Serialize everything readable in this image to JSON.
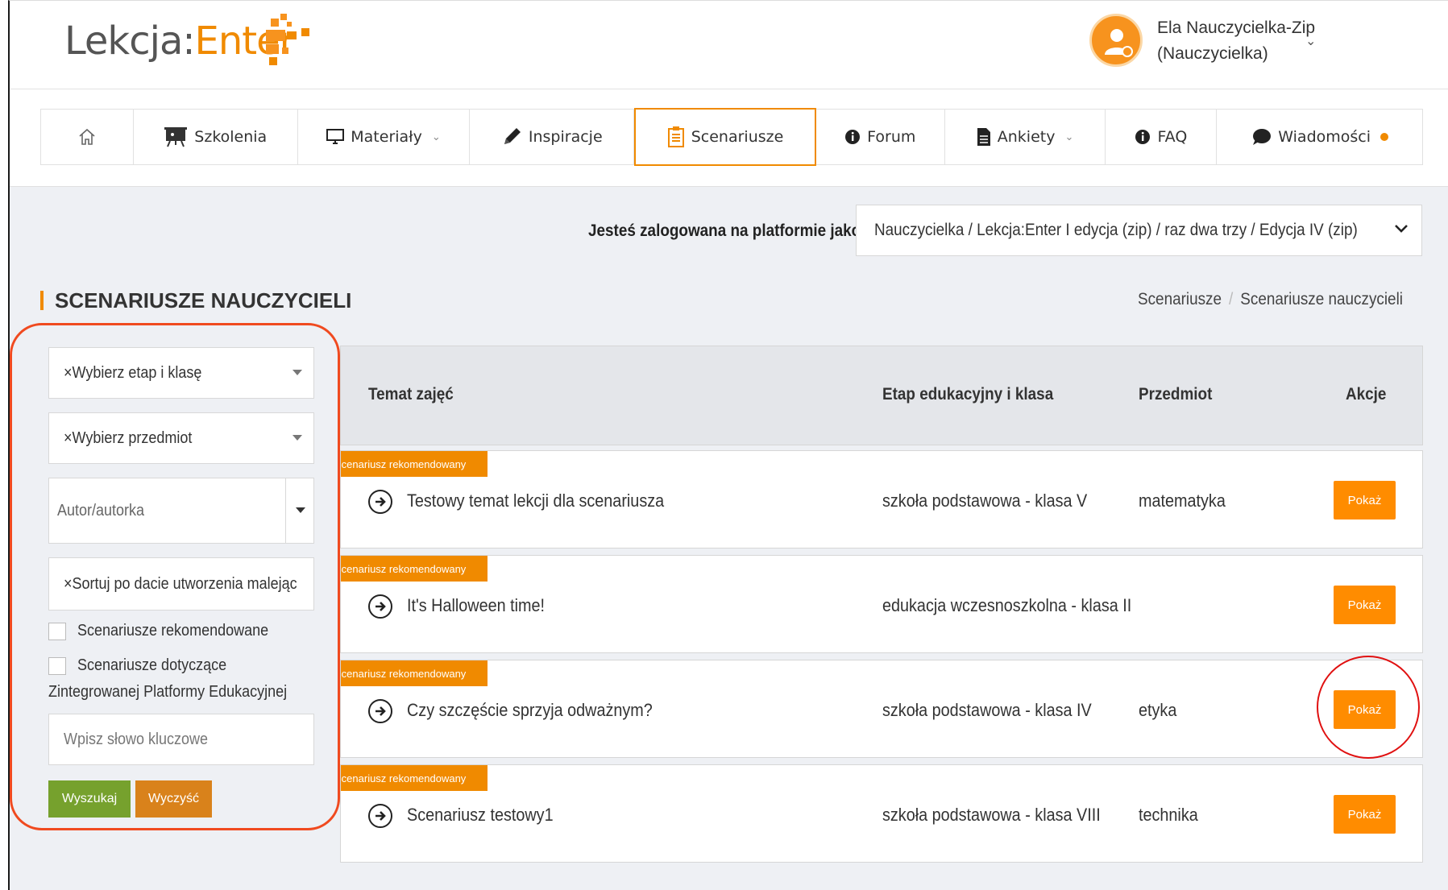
{
  "header": {
    "logo_part1": "Lekcja:",
    "logo_part2": "Enter",
    "user_name": "Ela Nauczycielka-Zip",
    "user_role": "(Nauczycielka)"
  },
  "nav": {
    "items": [
      {
        "label": "",
        "icon": "home-icon"
      },
      {
        "label": "Szkolenia",
        "icon": "presentation-board-icon"
      },
      {
        "label": "Materiały",
        "icon": "monitor-icon",
        "dropdown": true
      },
      {
        "label": "Inspiracje",
        "icon": "pencil-icon"
      },
      {
        "label": "Scenariusze",
        "icon": "clipboard-icon",
        "active": true
      },
      {
        "label": "Forum",
        "icon": "info-icon"
      },
      {
        "label": "Ankiety",
        "icon": "document-icon",
        "dropdown": true
      },
      {
        "label": "FAQ",
        "icon": "info-icon"
      },
      {
        "label": "Wiadomości",
        "icon": "chat-bubble-icon",
        "notification_dot": true
      }
    ]
  },
  "platform": {
    "label": "Jesteś zalogowana na platformie jako:",
    "selected": "Nauczycielka / Lekcja:Enter I edycja (zip) / raz dwa trzy / Edycja IV (zip)"
  },
  "page": {
    "title": "SCENARIUSZE NAUCZYCIELI",
    "breadcrumb": [
      "Scenariusze",
      "Scenariusze nauczycieli"
    ]
  },
  "filters": {
    "stage_select": "×Wybierz etap i klasę",
    "subject_select": "×Wybierz przedmiot",
    "author_placeholder": "Autor/autorka",
    "sort_select": "×Sortuj po dacie utworzenia malejąc",
    "checkbox_recommended": "Scenariusze rekomendowane",
    "checkbox_zpe_line1": "Scenariusze dotyczące",
    "checkbox_zpe_line2": "Zintegrowanej Platformy Edukacyjnej",
    "keyword_placeholder": "Wpisz słowo kluczowe",
    "search_button": "Wyszukaj",
    "clear_button": "Wyczyść"
  },
  "table": {
    "headers": [
      "Temat zajęć",
      "Etap edukacyjny i klasa",
      "Przedmiot",
      "Akcje"
    ],
    "rows": [
      {
        "badge": "Scenariusz rekomendowany",
        "topic": "Testowy temat lekcji dla scenariusza",
        "stage": "szkoła podstawowa - klasa V",
        "subject": "matematyka",
        "action": "Pokaż"
      },
      {
        "badge": "Scenariusz rekomendowany",
        "topic": "It's Halloween time!",
        "stage": "edukacja wczesnoszkolna - klasa II",
        "subject": "",
        "action": "Pokaż"
      },
      {
        "badge": "Scenariusz rekomendowany",
        "topic": "Czy szczęście sprzyja odważnym?",
        "stage": "szkoła podstawowa - klasa IV",
        "subject": "etyka",
        "action": "Pokaż"
      },
      {
        "badge": "Scenariusz rekomendowany",
        "topic": "Scenariusz testowy1",
        "stage": "szkoła podstawowa - klasa VIII",
        "subject": "technika",
        "action": "Pokaż"
      }
    ]
  },
  "colors": {
    "accent": "#f08a00",
    "action_button": "#ff8c00",
    "search_button": "#76a12d",
    "clear_button": "#d9821b",
    "annotation_red": "#f04a1f"
  }
}
